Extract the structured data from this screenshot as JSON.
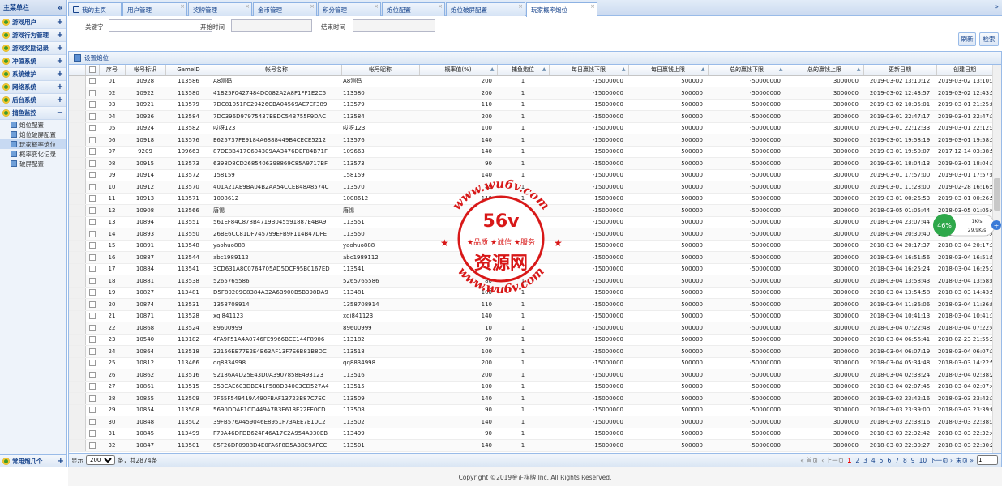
{
  "sidebar": {
    "title": "主菜单栏",
    "collapse_icon": "double-chevron-left-icon",
    "groups": [
      {
        "label": "游戏用户",
        "toggle": "+"
      },
      {
        "label": "游戏行为管理",
        "toggle": "+"
      },
      {
        "label": "游戏奖励记录",
        "toggle": "+"
      },
      {
        "label": "冲值系统",
        "toggle": "+"
      },
      {
        "label": "系统维护",
        "toggle": "+"
      },
      {
        "label": "网络系统",
        "toggle": "+"
      },
      {
        "label": "后台系统",
        "toggle": "+"
      },
      {
        "label": "捕鱼监控",
        "toggle": "−"
      }
    ],
    "children": [
      "炮位配置",
      "炮位破屏配置",
      "玩家概率炮位",
      "概率变化记录",
      "破屏配置"
    ],
    "selected_child": "玩家概率炮位",
    "footer": {
      "label": "常用炮几个",
      "toggle": "+"
    }
  },
  "tabs": [
    {
      "label": "我的主页",
      "close": ""
    },
    {
      "label": "用户管理",
      "close": "×"
    },
    {
      "label": "奖牌管理",
      "close": "×"
    },
    {
      "label": "金币管理",
      "close": "×"
    },
    {
      "label": "积分管理",
      "close": "×"
    },
    {
      "label": "炮位配置",
      "close": "×"
    },
    {
      "label": "炮位破屏配置",
      "close": "×"
    },
    {
      "label": "玩家概率炮位",
      "close": "×"
    }
  ],
  "tab_scroll": "»",
  "search": {
    "keyword_label": "关键字",
    "keyword_value": "",
    "start_label": "开始时间",
    "start_value": "",
    "end_label": "结束时间",
    "end_value": "",
    "refresh_label": "刷新",
    "search_label": "检索"
  },
  "panel": {
    "title": "设置炮位"
  },
  "columns": [
    "序号",
    "帐号标识",
    "GameID",
    "帐号名称",
    "帐号昵称",
    "概率值(%)",
    "捕鱼炮位",
    "每日赢钱下限",
    "每日赢钱上限",
    "总的赢钱下限",
    "总的赢钱上限",
    "更新日期",
    "创建日期"
  ],
  "rows": [
    [
      "01",
      "10928",
      "113586",
      "A8测码",
      "A8测码",
      "200",
      "1",
      "-15000000",
      "500000",
      "-50000000",
      "3000000",
      "2019-03-02 13:10:12",
      "2019-03-02 13:10:12"
    ],
    [
      "02",
      "10922",
      "113580",
      "41B25F0427484DC082A2A8F1FF1E2C5",
      "113580",
      "200",
      "1",
      "-15000000",
      "500000",
      "-50000000",
      "3000000",
      "2019-03-02 12:43:57",
      "2019-03-02 12:43:57"
    ],
    [
      "03",
      "10921",
      "113579",
      "7DC81051FC29426CBA04569AE7EF389",
      "113579",
      "110",
      "1",
      "-15000000",
      "500000",
      "-50000000",
      "3000000",
      "2019-03-02 10:35:01",
      "2019-03-01 21:25:01"
    ],
    [
      "04",
      "10926",
      "113584",
      "7DC396D97975437BEDC54B755F9DAC",
      "113584",
      "200",
      "1",
      "-15000000",
      "500000",
      "-50000000",
      "3000000",
      "2019-03-01 22:47:17",
      "2019-03-01 22:47:17"
    ],
    [
      "05",
      "10924",
      "113582",
      "哎呀123",
      "哎呀123",
      "100",
      "1",
      "-15000000",
      "500000",
      "-50000000",
      "3000000",
      "2019-03-01 22:12:33",
      "2019-03-01 22:12:33"
    ],
    [
      "06",
      "10918",
      "113576",
      "E625737FE9184A6888449B4CECE5212",
      "113576",
      "140",
      "1",
      "-15000000",
      "500000",
      "-50000000",
      "3000000",
      "2019-03-01 19:58:19",
      "2019-03-01 19:58:19"
    ],
    [
      "07",
      "9209",
      "109663",
      "87DE8B417C604309AA3476DEF84B71F",
      "109663",
      "140",
      "1",
      "-15000000",
      "500000",
      "-50000000",
      "3000000",
      "2019-03-01 19:50:07",
      "2017-12-14 03:38:51"
    ],
    [
      "08",
      "10915",
      "113573",
      "6398D8CD2685406398869C85A9717BF",
      "113573",
      "90",
      "1",
      "-15000000",
      "500000",
      "-50000000",
      "3000000",
      "2019-03-01 18:04:13",
      "2019-03-01 18:04:13"
    ],
    [
      "09",
      "10914",
      "113572",
      "158159",
      "158159",
      "140",
      "1",
      "-15000000",
      "500000",
      "-50000000",
      "3000000",
      "2019-03-01 17:57:00",
      "2019-03-01 17:57:00"
    ],
    [
      "10",
      "10912",
      "113570",
      "401A21AE9BA04B2AA54CCEB48A8574C",
      "113570",
      "85",
      "1",
      "-15000000",
      "500000",
      "-50000000",
      "3000000",
      "2019-03-01 11:28:00",
      "2019-02-28 16:16:58"
    ],
    [
      "11",
      "10913",
      "113571",
      "1008612",
      "1008612",
      "110",
      "1",
      "-15000000",
      "500000",
      "-50000000",
      "3000000",
      "2019-03-01 00:26:53",
      "2019-03-01 00:26:53"
    ],
    [
      "12",
      "10908",
      "113566",
      "唐锡",
      "唐锡",
      "90",
      "1",
      "-15000000",
      "500000",
      "-50000000",
      "3000000",
      "2018-03-05 01:05:44",
      "2018-03-05 01:05:44"
    ],
    [
      "13",
      "10894",
      "113551",
      "561EF84C878B4719B045591887E4BA9",
      "113551",
      "110",
      "1",
      "-15000000",
      "500000",
      "-50000000",
      "3000000",
      "2018-03-04 23:07:44",
      "2018-03-04 23:07:44"
    ],
    [
      "14",
      "10893",
      "113550",
      "26BE6CC81DF745799EFB9F114B47DFE",
      "113550",
      "110",
      "1",
      "-15000000",
      "500000",
      "-50000000",
      "3000000",
      "2018-03-04 20:30:40",
      "2018-03-04 20:30:40"
    ],
    [
      "15",
      "10891",
      "113548",
      "yaohuo888",
      "yaohuo888",
      "90",
      "1",
      "-15000000",
      "500000",
      "-50000000",
      "3000000",
      "2018-03-04 20:17:37",
      "2018-03-04 20:17:37"
    ],
    [
      "16",
      "10887",
      "113544",
      "abc1989112",
      "abc1989112",
      "80",
      "1",
      "-15000000",
      "500000",
      "-50000000",
      "3000000",
      "2018-03-04 16:51:56",
      "2018-03-04 16:51:56"
    ],
    [
      "17",
      "10884",
      "113541",
      "3CD631A8C0764705AD5DCF95B0167ED",
      "113541",
      "200",
      "1",
      "-15000000",
      "500000",
      "-50000000",
      "3000000",
      "2018-03-04 16:25:24",
      "2018-03-04 16:25:24"
    ],
    [
      "18",
      "10881",
      "113538",
      "5265765586",
      "5265765586",
      "80",
      "1",
      "-15000000",
      "500000",
      "-50000000",
      "3000000",
      "2018-03-04 13:58:43",
      "2018-03-04 13:58:00"
    ],
    [
      "19",
      "10827",
      "113481",
      "D5F80209C8384A32A6B900B5B398DA9",
      "113481",
      "100",
      "1",
      "-15000000",
      "500000",
      "-50000000",
      "3000000",
      "2018-03-04 13:54:58",
      "2018-03-03 14:43:50"
    ],
    [
      "20",
      "10874",
      "113531",
      "1358708914",
      "1358708914",
      "110",
      "1",
      "-15000000",
      "500000",
      "-50000000",
      "3000000",
      "2018-03-04 11:36:06",
      "2018-03-04 11:36:06"
    ],
    [
      "21",
      "10871",
      "113528",
      "xqi841123",
      "xqi841123",
      "140",
      "1",
      "-15000000",
      "500000",
      "-50000000",
      "3000000",
      "2018-03-04 10:41:13",
      "2018-03-04 10:41:13"
    ],
    [
      "22",
      "10868",
      "113524",
      "89600999",
      "89600999",
      "10",
      "1",
      "-15000000",
      "500000",
      "-50000000",
      "3000000",
      "2018-03-04 07:22:48",
      "2018-03-04 07:22:48"
    ],
    [
      "23",
      "10540",
      "113182",
      "4FA9F51A4A0746FE9966BCE144F8906",
      "113182",
      "90",
      "1",
      "-15000000",
      "500000",
      "-50000000",
      "3000000",
      "2018-03-04 06:56:41",
      "2018-02-23 21:55:36"
    ],
    [
      "24",
      "10864",
      "113518",
      "32156EE77E2E4B63AF13F7E6B81B8DC",
      "113518",
      "100",
      "1",
      "-15000000",
      "500000",
      "-50000000",
      "3000000",
      "2018-03-04 06:07:19",
      "2018-03-04 06:07:19"
    ],
    [
      "25",
      "10812",
      "113466",
      "qq8834998",
      "qq8834998",
      "200",
      "1",
      "-15000000",
      "500000",
      "-50000000",
      "3000000",
      "2018-03-04 05:34:48",
      "2018-03-03 14:22:57"
    ],
    [
      "26",
      "10862",
      "113516",
      "92186A4D25E43D0A3907858E493123",
      "113516",
      "200",
      "1",
      "-15000000",
      "500000",
      "-50000000",
      "3000000",
      "2018-03-04 02:38:24",
      "2018-03-04 02:38:24"
    ],
    [
      "27",
      "10861",
      "113515",
      "353CAE603DBC41F588D34003CD527A4",
      "113515",
      "100",
      "1",
      "-15000000",
      "500000",
      "-50000000",
      "3000000",
      "2018-03-04 02:07:45",
      "2018-03-04 02:07:45"
    ],
    [
      "28",
      "10855",
      "113509",
      "7F65F549419A490FBAF13723B87C7EC",
      "113509",
      "140",
      "1",
      "-15000000",
      "500000",
      "-50000000",
      "3000000",
      "2018-03-03 23:42:16",
      "2018-03-03 23:42:16"
    ],
    [
      "29",
      "10854",
      "113508",
      "5690DDAE1CD449A7B3E618E22FE0CD",
      "113508",
      "90",
      "1",
      "-15000000",
      "500000",
      "-50000000",
      "3000000",
      "2018-03-03 23:39:00",
      "2018-03-03 23:39:00"
    ],
    [
      "30",
      "10848",
      "113502",
      "39FB576A459046E8951F73AEE7E10C2",
      "113502",
      "140",
      "1",
      "-15000000",
      "500000",
      "-50000000",
      "3000000",
      "2018-03-03 22:38:16",
      "2018-03-03 22:38:16"
    ],
    [
      "31",
      "10845",
      "113499",
      "F79A46DFDB624F46A17C2A954A930EB",
      "113499",
      "90",
      "1",
      "-15000000",
      "500000",
      "-50000000",
      "3000000",
      "2018-03-03 22:32:42",
      "2018-03-03 22:32:42"
    ],
    [
      "32",
      "10847",
      "113501",
      "85F26DF0988D4E0FA6F8D5A3BE9AFCC",
      "113501",
      "140",
      "1",
      "-15000000",
      "500000",
      "-50000000",
      "3000000",
      "2018-03-03 22:30:27",
      "2018-03-03 22:30:27"
    ]
  ],
  "pager": {
    "show_label": "显示",
    "page_size": "200",
    "total_text": "条，共2874条",
    "first": "首页",
    "prev": "上一页",
    "pages": [
      "1",
      "2",
      "3",
      "4",
      "5",
      "6",
      "7",
      "8",
      "9",
      "10"
    ],
    "current": "1",
    "next": "下一页",
    "last": "末页",
    "page_input": "1"
  },
  "footer": {
    "copyright": "Copyright ©2019金正棋牌 Inc. All Rights Reserved."
  },
  "watermark": {
    "arc_top": "www.wu6v.com",
    "brand": "56v",
    "slogan": "★品质 ★诚信 ★服务",
    "name": "资源网",
    "arc_bottom": "www.wu6v.com",
    "color": "#d81818"
  },
  "net_widget": {
    "percent": "46%",
    "up": "1K/s",
    "down": "29.9K/s"
  }
}
